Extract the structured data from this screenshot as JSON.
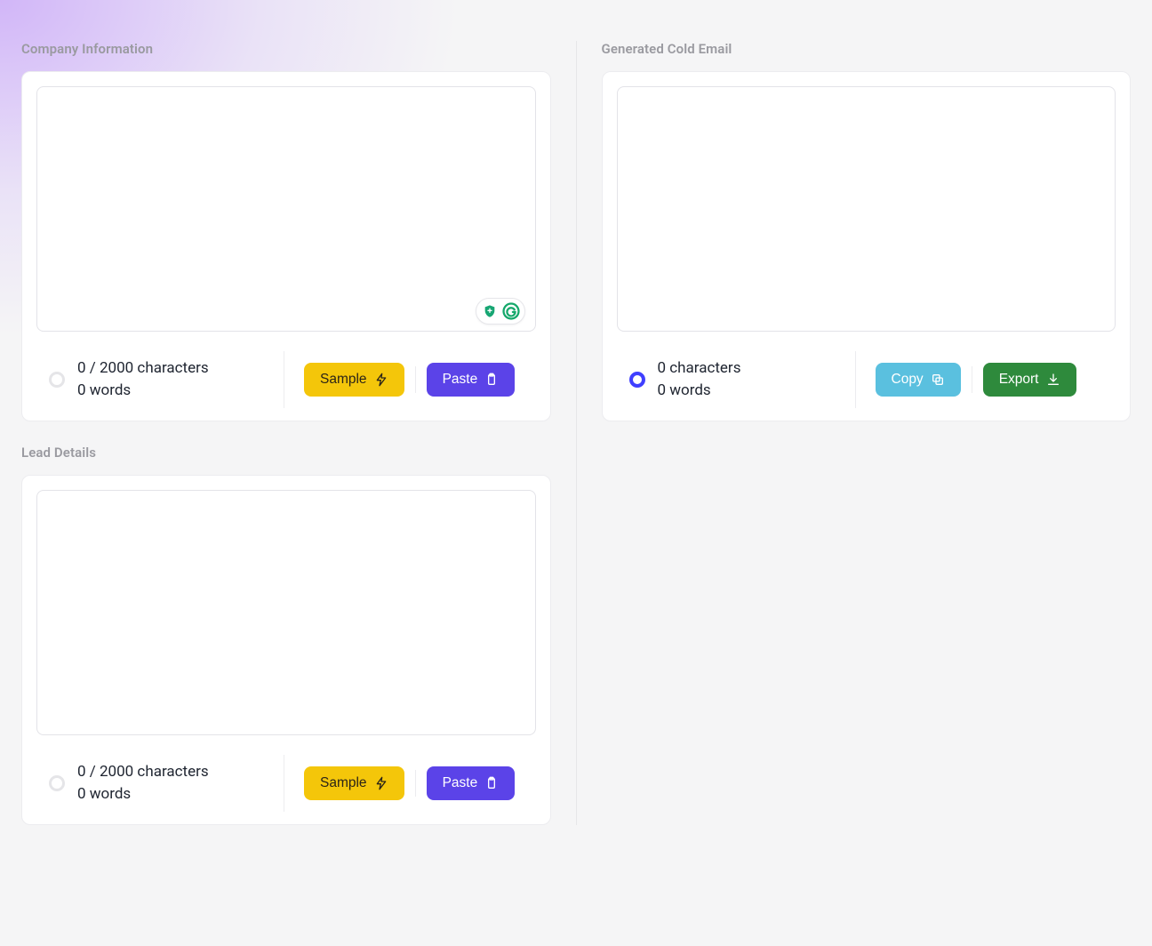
{
  "left": {
    "company": {
      "label": "Company Information",
      "value": "",
      "char_text": "0 / 2000 characters",
      "word_text": "0 words",
      "sample_label": "Sample",
      "paste_label": "Paste"
    },
    "lead": {
      "label": "Lead Details",
      "value": "",
      "char_text": "0 / 2000 characters",
      "word_text": "0 words",
      "sample_label": "Sample",
      "paste_label": "Paste"
    }
  },
  "right": {
    "output": {
      "label": "Generated Cold Email",
      "value": "",
      "char_text": "0 characters",
      "word_text": "0 words",
      "copy_label": "Copy",
      "export_label": "Export"
    }
  },
  "colors": {
    "sample_btn": "#f4c60a",
    "paste_btn": "#5b43e8",
    "copy_btn": "#5ac0df",
    "export_btn": "#2e8a3c",
    "radio_active": "#3f3fff"
  }
}
